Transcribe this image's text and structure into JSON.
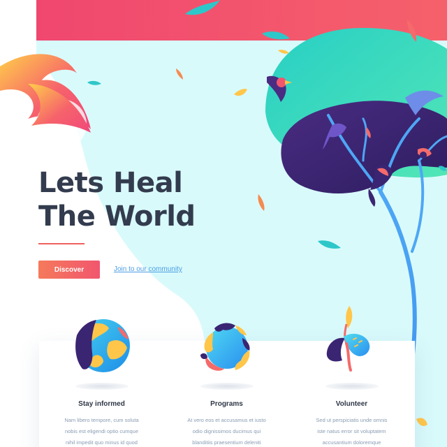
{
  "hero": {
    "title_line1": "Lets Heal",
    "title_line2": "The World",
    "discover_label": "Discover",
    "community_link": "Join to our community"
  },
  "features": [
    {
      "icon": "globe-icon",
      "title": "Stay informed",
      "lines": [
        "Nam libero tempore, cum soluta",
        "nobis est eligendi optio cumque",
        "nihil impedit quo minus id quod"
      ]
    },
    {
      "icon": "hands-circle-icon",
      "title": "Programs",
      "lines": [
        "At vero eos et accusamus et iusto",
        "odio dignissimos ducimus qui",
        "blanditiis praesentium deleniti"
      ]
    },
    {
      "icon": "sprout-icon",
      "title": "Volunteer",
      "lines": [
        "Sed ut perspiciatis unde omnis",
        "iste natus error sit voluptatem",
        "accusantium doloremque"
      ]
    }
  ],
  "colors": {
    "title": "#333c4e",
    "accent": "#f1566e",
    "link": "#4a9de4",
    "sky": "#d8fafb",
    "top_band": "#f0466a",
    "tree_canopy": "#2ad3c2",
    "leaf_dark": "#3a2572"
  }
}
